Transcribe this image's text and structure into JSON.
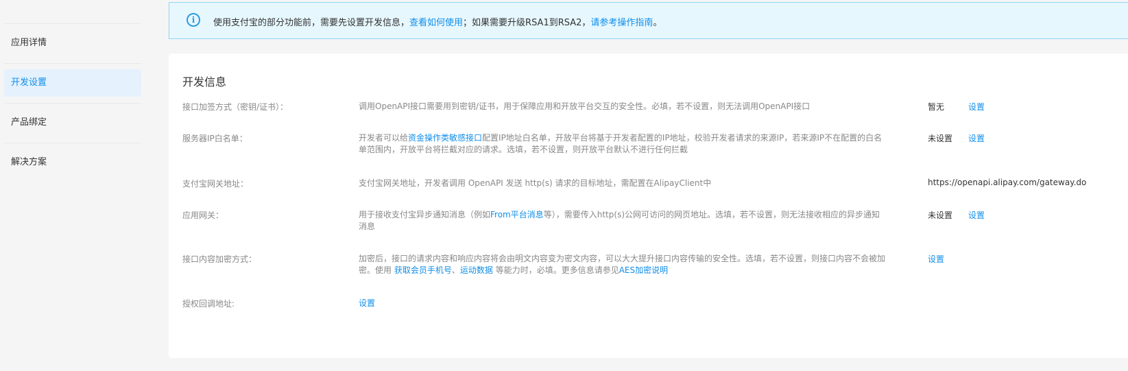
{
  "sidebar": {
    "items": [
      {
        "label": "应用详情",
        "active": false
      },
      {
        "label": "开发设置",
        "active": true
      },
      {
        "label": "产品绑定",
        "active": false
      },
      {
        "label": "解决方案",
        "active": false
      }
    ]
  },
  "notice": {
    "icon": "info-icon",
    "text_1": "使用支付宝的部分功能前，需要先设置开发信息，",
    "link_1": "查看如何使用",
    "text_2": "；如果需要升级RSA1到RSA2，",
    "link_2": "请参考操作指南",
    "text_3": "。"
  },
  "card": {
    "title": "开发信息",
    "rows": {
      "sign": {
        "label": "接口加签方式（密钥/证书）：",
        "desc": "调用OpenAPI接口需要用到密钥/证书，用于保障应用和开放平台交互的安全性。必填，若不设置，则无法调用OpenAPI接口",
        "value": "暂无",
        "action": "设置"
      },
      "ip": {
        "label": "服务器IP白名单：",
        "desc_1": "开发者可以给",
        "desc_link": "资金操作类敏感接口",
        "desc_2": "配置IP地址白名单，开放平台将基于开发者配置的IP地址，校验开发者请求的来源IP，若来源IP不在配置的白名单范围内，开放平台将拦截对应的请求。选填，若不设置，则开放平台默认不进行任何拦截",
        "value": "未设置",
        "action": "设置"
      },
      "gateway": {
        "label": "支付宝网关地址：",
        "desc": "支付宝网关地址，开发者调用 OpenAPI 发送 http(s) 请求的目标地址，需配置在AlipayClient中",
        "value": "https://openapi.alipay.com/gateway.do"
      },
      "app_gateway": {
        "label": "应用网关：",
        "desc_1": "用于接收支付宝异步通知消息（例如",
        "desc_link": "From平台消息",
        "desc_2": "等），需要传入http(s)公网可访问的网页地址。选填，若不设置，则无法接收相应的异步通知消息",
        "value": "未设置",
        "action": "设置"
      },
      "encrypt": {
        "label": "接口内容加密方式：",
        "desc_1": "加密后，接口的请求内容和响应内容将会由明文内容变为密文内容，可以大大提升接口内容传输的安全性。选填，若不设置，则接口内容不会被加密。使用 ",
        "desc_link_1": "获取会员手机号",
        "desc_sep": "、",
        "desc_link_2": "运动数据",
        "desc_2": " 等能力时，必填。更多信息请参见",
        "desc_link_3": "AES加密说明",
        "action": "设置"
      },
      "callback": {
        "label": "授权回调地址:",
        "action": "设置"
      }
    }
  }
}
